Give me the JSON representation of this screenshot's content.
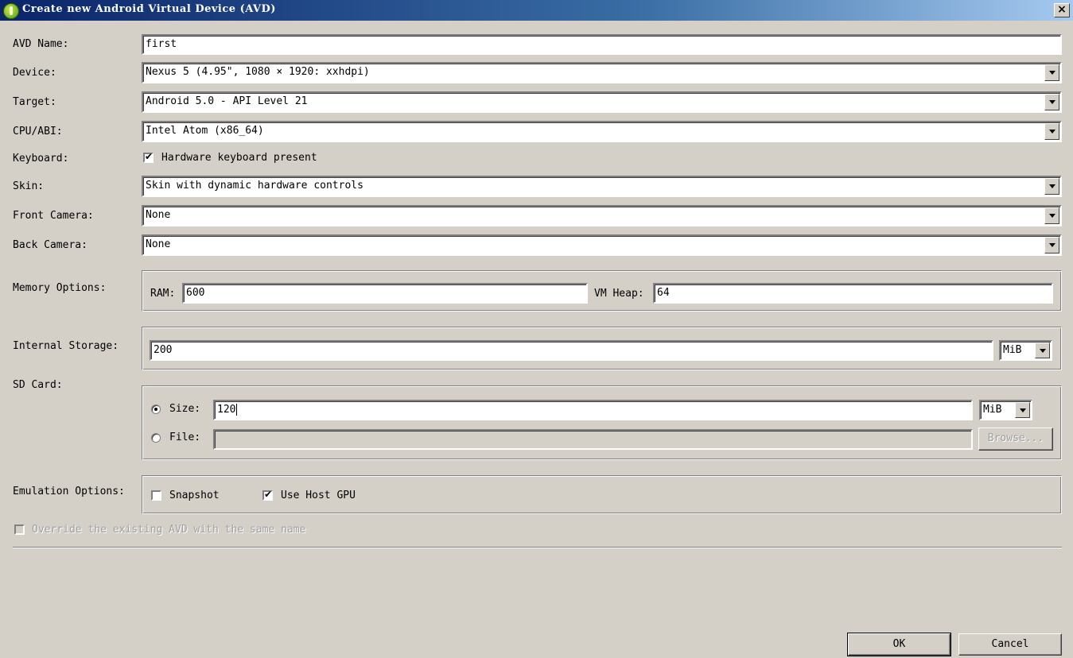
{
  "window": {
    "title": "Create new Android Virtual Device (AVD)",
    "close_glyph": "×"
  },
  "form": {
    "avd_name": {
      "label": "AVD Name:",
      "value": "first"
    },
    "device": {
      "label": "Device:",
      "value": "Nexus 5 (4.95\", 1080 × 1920: xxhdpi)"
    },
    "target": {
      "label": "Target:",
      "value": "Android 5.0 - API Level 21"
    },
    "cpu_abi": {
      "label": "CPU/ABI:",
      "value": "Intel Atom (x86_64)"
    },
    "keyboard": {
      "label": "Keyboard:",
      "checkbox_label": "Hardware keyboard present",
      "checked": true
    },
    "skin": {
      "label": "Skin:",
      "value": "Skin with dynamic hardware controls"
    },
    "front_camera": {
      "label": "Front Camera:",
      "value": "None"
    },
    "back_camera": {
      "label": "Back Camera:",
      "value": "None"
    },
    "memory": {
      "label": "Memory Options:",
      "ram_label": "RAM:",
      "ram_value": "600",
      "vm_heap_label": "VM Heap:",
      "vm_heap_value": "64"
    },
    "internal_storage": {
      "label": "Internal Storage:",
      "value": "200",
      "unit": "MiB"
    },
    "sd_card": {
      "label": "SD Card:",
      "size_label": "Size:",
      "size_value": "120",
      "size_unit": "MiB",
      "size_selected": true,
      "file_label": "File:",
      "file_value": "",
      "browse_label": "Browse..."
    },
    "emulation": {
      "label": "Emulation Options:",
      "snapshot_label": "Snapshot",
      "snapshot_checked": false,
      "host_gpu_label": "Use Host GPU",
      "host_gpu_checked": true
    },
    "override": {
      "label": "Override the existing AVD with the same name",
      "checked": false,
      "enabled": false
    }
  },
  "buttons": {
    "ok": "OK",
    "cancel": "Cancel"
  },
  "colors": {
    "dialog_bg": "#d4d0c8",
    "titlebar_start": "#0a246a",
    "titlebar_end": "#a6caf0"
  }
}
